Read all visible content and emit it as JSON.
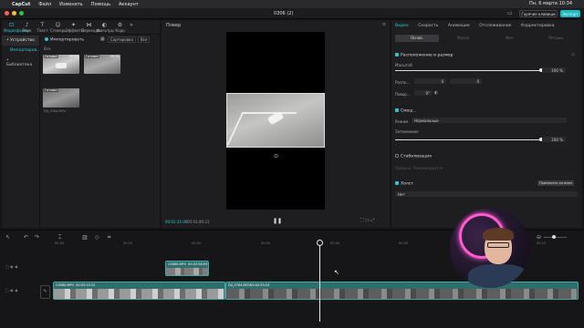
{
  "menubar": {
    "apple": "",
    "items": [
      "CapCut",
      "Файл",
      "Изменить",
      "Помощь",
      "Аккаунт"
    ],
    "clock": "Пн, 6 марта 10:34"
  },
  "app": {
    "project_title": "0306 (2)",
    "shortcuts_label": "Горячие клавиши",
    "export_label": "Экспорт"
  },
  "media_toolbar": [
    {
      "label": "Медиафайлы",
      "icon": "media-icon",
      "glyph": "⊡"
    },
    {
      "label": "Звук",
      "icon": "audio-icon",
      "glyph": "♪"
    },
    {
      "label": "Текст",
      "icon": "text-icon",
      "glyph": "T"
    },
    {
      "label": "Стикеры",
      "icon": "sticker-icon",
      "glyph": "☺"
    },
    {
      "label": "Эффекты",
      "icon": "effects-icon",
      "glyph": "✦"
    },
    {
      "label": "Переходы",
      "icon": "transitions-icon",
      "glyph": "⋈"
    },
    {
      "label": "Фильтры",
      "icon": "filters-icon",
      "glyph": "◐"
    },
    {
      "label": "Корр",
      "icon": "adjust-icon",
      "glyph": "⚙"
    }
  ],
  "sidebar": {
    "items": [
      "• Устройство",
      "Импортиров...",
      "• Библиотека"
    ]
  },
  "media": {
    "import_label": "Импортировать",
    "sort_label": "Сортировка",
    "all_label": "Все",
    "filter_all": "Все",
    "clips": [
      {
        "tag": "Готово!",
        "duration": "00:14",
        "name": ""
      },
      {
        "tag": "Готово!",
        "duration": "00:01",
        "name": ""
      },
      {
        "tag": "Готово!",
        "duration": "",
        "name": "DJI_0784.MOV"
      }
    ]
  },
  "player": {
    "title": "Плеер",
    "time_current": "00:01:35:06",
    "time_total": "00:03:49:21"
  },
  "inspector": {
    "tabs": [
      "Видео",
      "Скорость",
      "Анимация",
      "Отслеживание",
      "Корректировка"
    ],
    "subtabs": [
      "Основ.",
      "Маска",
      "Фон",
      "Ретушь"
    ],
    "section_transform": "Расположение и размер",
    "scale_label": "Масштаб",
    "scale_value": "100 %",
    "scale_fraction": 1.0,
    "position_label": "Распо...",
    "pos_x": "0",
    "pos_y": "0",
    "rotate_label": "Повор...",
    "rotate_value": "0°",
    "section_blend": "Смеш...",
    "mode_label": "Режим",
    "mode_value": "Нормальные",
    "opacity_label": "Затемнение",
    "opacity_value": "100 %",
    "opacity_fraction": 1.0,
    "section_stab": "Стабилизация",
    "stab_value": "Уровень: Рекомендуется",
    "section_canvas": "Холст",
    "canvas_value": "Нет",
    "apply_all": "Применить ко всем"
  },
  "timeline": {
    "ruler": [
      "00:00",
      "00:10",
      "00:20",
      "00:30",
      "00:40",
      "00:50",
      "01:00",
      "01:10",
      "01:20"
    ],
    "overlay_clip": {
      "name": "C0080.MP4",
      "duration": "00:03:56:09"
    },
    "main_clip1": {
      "name": "C0080.MP4",
      "duration": "00:03:14:22"
    },
    "main_clip2": {
      "name": "DJI_0784.MOV",
      "duration": "00:02:53:24"
    },
    "cover_label": "Обложка"
  },
  "colors": {
    "accent": "#2ec4d0",
    "track": "#2e6e6c",
    "export": "#1fb8c4"
  }
}
